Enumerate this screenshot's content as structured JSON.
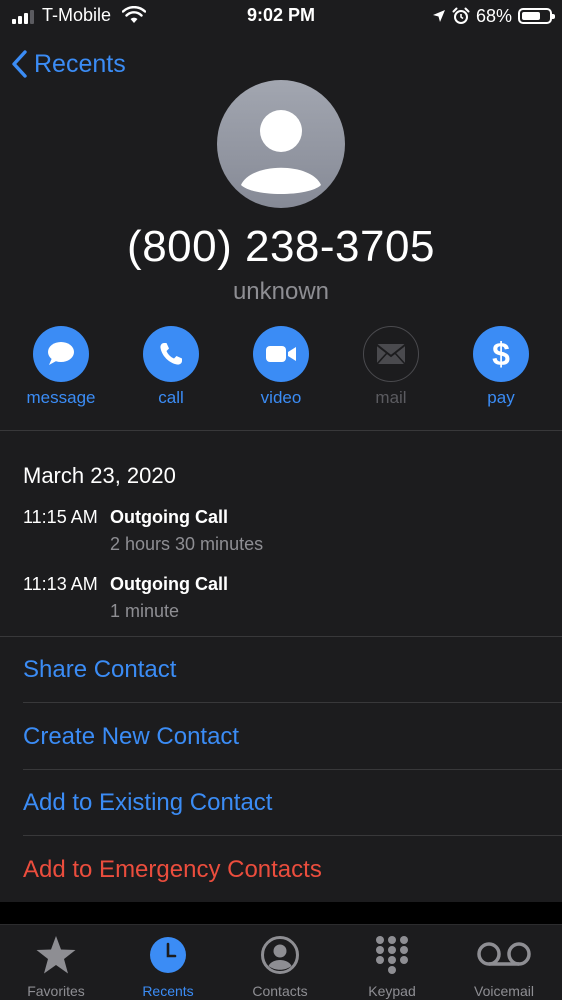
{
  "status_bar": {
    "carrier": "T-Mobile",
    "time": "9:02 PM",
    "battery": "68%",
    "battery_level": 0.68
  },
  "nav": {
    "back_label": "Recents"
  },
  "contact": {
    "phone": "(800) 238-3705",
    "label": "unknown"
  },
  "actions": [
    {
      "label": "message",
      "icon": "message-bubble-icon",
      "enabled": true
    },
    {
      "label": "call",
      "icon": "phone-icon",
      "enabled": true
    },
    {
      "label": "video",
      "icon": "video-camera-icon",
      "enabled": true
    },
    {
      "label": "mail",
      "icon": "envelope-icon",
      "enabled": false
    },
    {
      "label": "pay",
      "icon": "dollar-icon",
      "enabled": true
    }
  ],
  "history": {
    "date": "March 23, 2020",
    "calls": [
      {
        "time": "11:15 AM",
        "type": "Outgoing Call",
        "duration": "2 hours 30 minutes"
      },
      {
        "time": "11:13 AM",
        "type": "Outgoing Call",
        "duration": "1 minute"
      }
    ]
  },
  "options": [
    {
      "label": "Share Contact"
    },
    {
      "label": "Create New Contact"
    },
    {
      "label": "Add to Existing Contact"
    },
    {
      "label": "Add to Emergency Contacts"
    }
  ],
  "tabs": [
    {
      "label": "Favorites",
      "icon": "star-icon",
      "active": false
    },
    {
      "label": "Recents",
      "icon": "clock-icon",
      "active": true
    },
    {
      "label": "Contacts",
      "icon": "person-circle-icon",
      "active": false
    },
    {
      "label": "Keypad",
      "icon": "keypad-icon",
      "active": false
    },
    {
      "label": "Voicemail",
      "icon": "voicemail-icon",
      "active": false
    }
  ],
  "colors": {
    "accent": "#3b8cf5",
    "destructive": "#eb4d3d",
    "background": "#1c1c1e",
    "secondary_text": "#8e8e93"
  }
}
